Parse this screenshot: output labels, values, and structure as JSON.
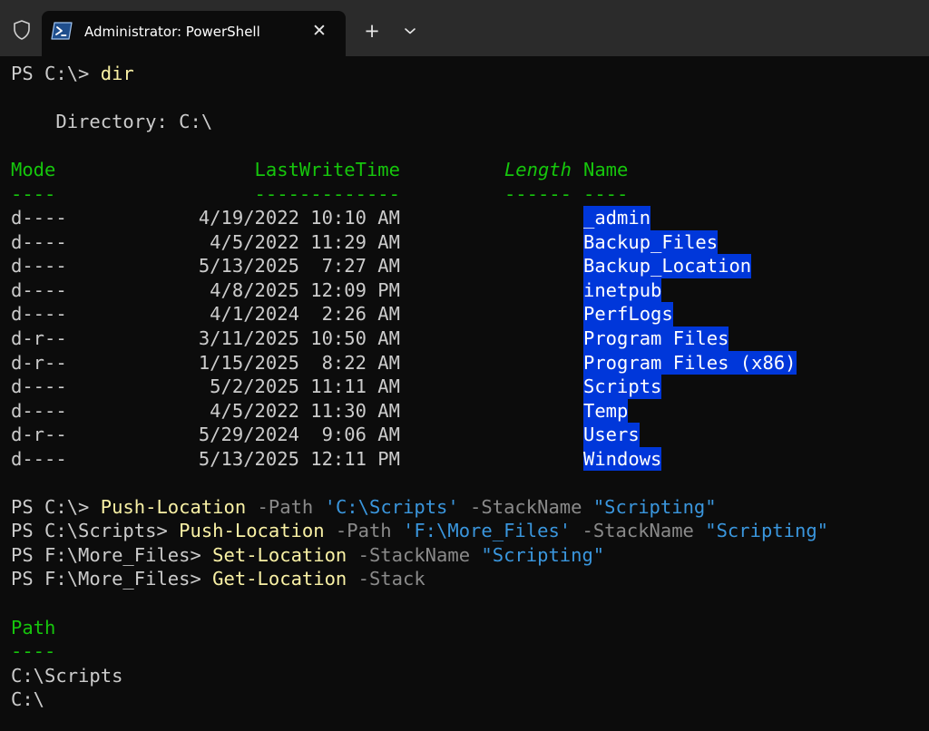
{
  "window": {
    "tab_title": "Administrator: PowerShell",
    "close_glyph": "✕",
    "new_tab_glyph": "+",
    "icons": {
      "shield": "shield-icon",
      "tab": "powershell-icon",
      "dropdown": "chevron-down-icon"
    }
  },
  "colors": {
    "background": "#0c0c0c",
    "titlebar": "#2b2b2b",
    "command": "#f9f1a5",
    "parameter": "#8a8a8a",
    "string": "#3a96dd",
    "header": "#16c60c",
    "selection": "#0037da"
  },
  "session": {
    "dir": {
      "prompt": "PS C:\\> ",
      "command": "dir"
    },
    "directory_label": "    Directory: C:\\",
    "table": {
      "headers": {
        "mode": "Mode",
        "lastwritetime": "LastWriteTime",
        "length": "Length",
        "name": "Name"
      },
      "underlines": {
        "mode": "----",
        "lastwritetime": "-------------",
        "length": "------",
        "name": "----"
      },
      "rows": [
        {
          "mode": "d----",
          "lastwritetime": "4/19/2022 10:10 AM",
          "name": "_admin"
        },
        {
          "mode": "d----",
          "lastwritetime": "4/5/2022 11:29 AM",
          "name": "Backup_Files"
        },
        {
          "mode": "d----",
          "lastwritetime": "5/13/2025  7:27 AM",
          "name": "Backup_Location"
        },
        {
          "mode": "d----",
          "lastwritetime": "4/8/2025 12:09 PM",
          "name": "inetpub"
        },
        {
          "mode": "d----",
          "lastwritetime": "4/1/2024  2:26 AM",
          "name": "PerfLogs"
        },
        {
          "mode": "d-r--",
          "lastwritetime": "3/11/2025 10:50 AM",
          "name": "Program Files"
        },
        {
          "mode": "d-r--",
          "lastwritetime": "1/15/2025  8:22 AM",
          "name": "Program Files (x86)"
        },
        {
          "mode": "d----",
          "lastwritetime": "5/2/2025 11:11 AM",
          "name": "Scripts"
        },
        {
          "mode": "d----",
          "lastwritetime": "4/5/2022 11:30 AM",
          "name": "Temp"
        },
        {
          "mode": "d-r--",
          "lastwritetime": "5/29/2024  9:06 AM",
          "name": "Users"
        },
        {
          "mode": "d----",
          "lastwritetime": "5/13/2025 12:11 PM",
          "name": "Windows"
        }
      ]
    },
    "commands": [
      {
        "prompt": "PS C:\\> ",
        "cmdlet": "Push-Location",
        "p1": " -Path ",
        "v1": "'C:\\Scripts'",
        "p2": " -StackName ",
        "v2": "\"Scripting\""
      },
      {
        "prompt": "PS C:\\Scripts> ",
        "cmdlet": "Push-Location",
        "p1": " -Path ",
        "v1": "'F:\\More_Files'",
        "p2": " -StackName ",
        "v2": "\"Scripting\""
      },
      {
        "prompt": "PS F:\\More_Files> ",
        "cmdlet": "Set-Location",
        "p1": " -StackName ",
        "v1": "\"Scripting\""
      },
      {
        "prompt": "PS F:\\More_Files> ",
        "cmdlet": "Get-Location",
        "p1": " -Stack"
      }
    ],
    "path_table": {
      "header": "Path",
      "underline": "----",
      "rows": [
        "C:\\Scripts",
        "C:\\"
      ]
    }
  }
}
